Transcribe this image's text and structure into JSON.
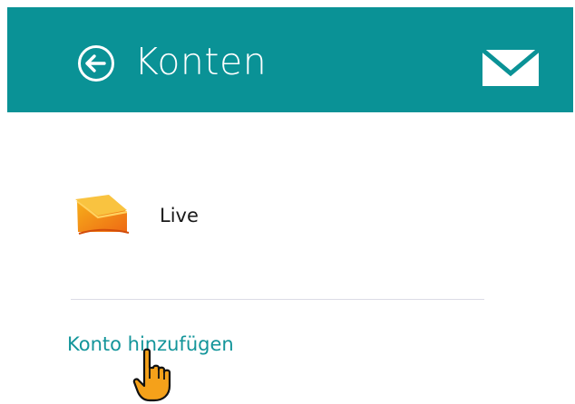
{
  "header": {
    "title": "Konten",
    "background_color": "#0a9296",
    "back_icon": "back-arrow-circle-icon",
    "mail_icon": "mail-envelope-icon"
  },
  "accounts": [
    {
      "name": "Live",
      "icon": "outlook-live-envelope-icon"
    }
  ],
  "actions": {
    "add_account_label": "Konto hinzufügen",
    "link_color": "#13959a"
  },
  "cursor": {
    "icon": "hand-pointer-icon"
  }
}
